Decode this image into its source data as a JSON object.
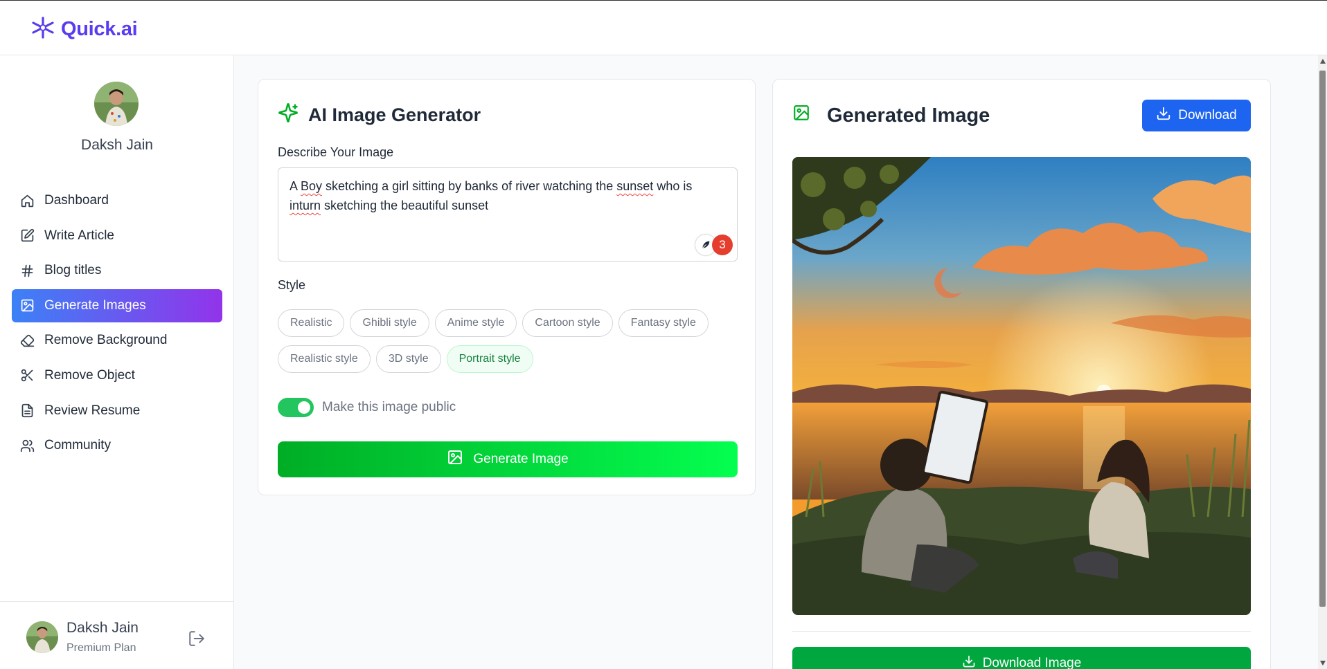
{
  "app": {
    "name": "Quick.ai",
    "brand_color": "#5b3bf0"
  },
  "user": {
    "name": "Daksh Jain",
    "plan": "Premium Plan"
  },
  "sidebar": {
    "items": [
      {
        "label": "Dashboard",
        "icon": "house-icon"
      },
      {
        "label": "Write Article",
        "icon": "square-pen-icon"
      },
      {
        "label": "Blog titles",
        "icon": "hash-icon"
      },
      {
        "label": "Generate Images",
        "icon": "image-icon",
        "active": true
      },
      {
        "label": "Remove Background",
        "icon": "eraser-icon"
      },
      {
        "label": "Remove Object",
        "icon": "scissors-icon"
      },
      {
        "label": "Review Resume",
        "icon": "file-text-icon"
      },
      {
        "label": "Community",
        "icon": "users-icon"
      }
    ],
    "active_gradient": [
      "#3c81f6",
      "#9234ea"
    ]
  },
  "generator": {
    "title": "AI Image Generator",
    "prompt_label": "Describe Your Image",
    "prompt_parts": [
      "A ",
      "Boy",
      " sketching a girl sitting by banks of river watching the ",
      "sunset",
      " who is ",
      "inturn",
      " sketching the beautiful sunset"
    ],
    "grammar_count": "3",
    "style_label": "Style",
    "styles": [
      "Realistic",
      "Ghibli style",
      "Anime style",
      "Cartoon style",
      "Fantasy style",
      "Realistic style",
      "3D style",
      "Portrait style"
    ],
    "selected_style": "Portrait style",
    "public_toggle_label": "Make this image public",
    "public_toggle_on": true,
    "generate_button": "Generate Image",
    "accent": "#00ad25"
  },
  "result": {
    "title": "Generated Image",
    "download_button": "Download",
    "download_image_button": "Download Image"
  }
}
